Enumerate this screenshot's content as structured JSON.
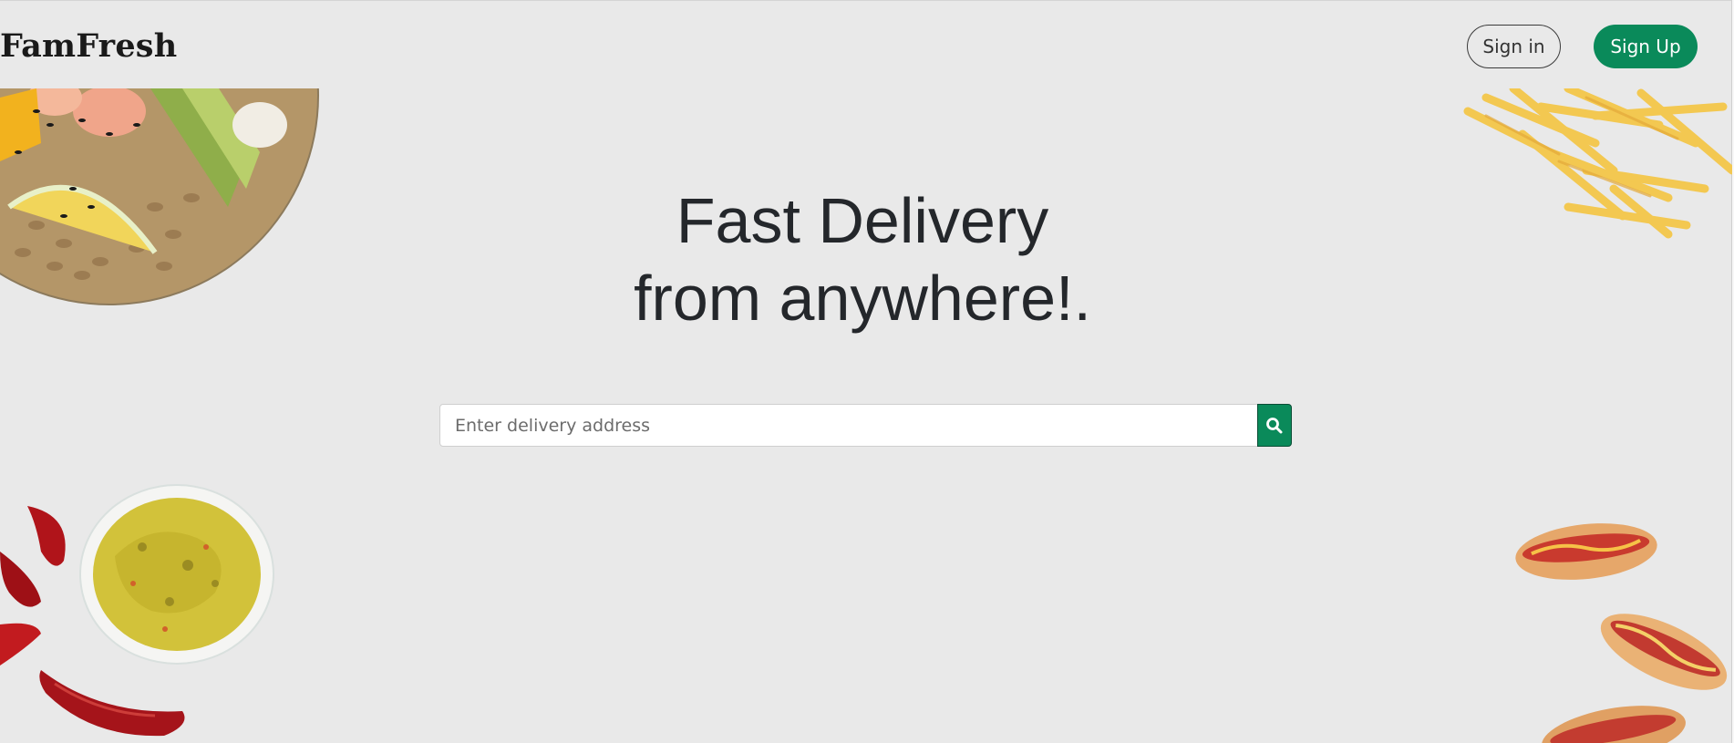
{
  "header": {
    "brand": "FamFresh",
    "signin_label": "Sign in",
    "signup_label": "Sign Up"
  },
  "hero": {
    "line1": "Fast Delivery",
    "line2": "from anywhere!."
  },
  "search": {
    "placeholder": "Enter delivery address",
    "button_icon": "search-icon"
  },
  "colors": {
    "background": "#e9e9e9",
    "accent": "#0a8a5a",
    "text": "#24272b"
  },
  "images": [
    "poke-bowl-image",
    "french-fries-image",
    "chili-peppers-image",
    "guacamole-bowl-image",
    "hot-dogs-image"
  ]
}
